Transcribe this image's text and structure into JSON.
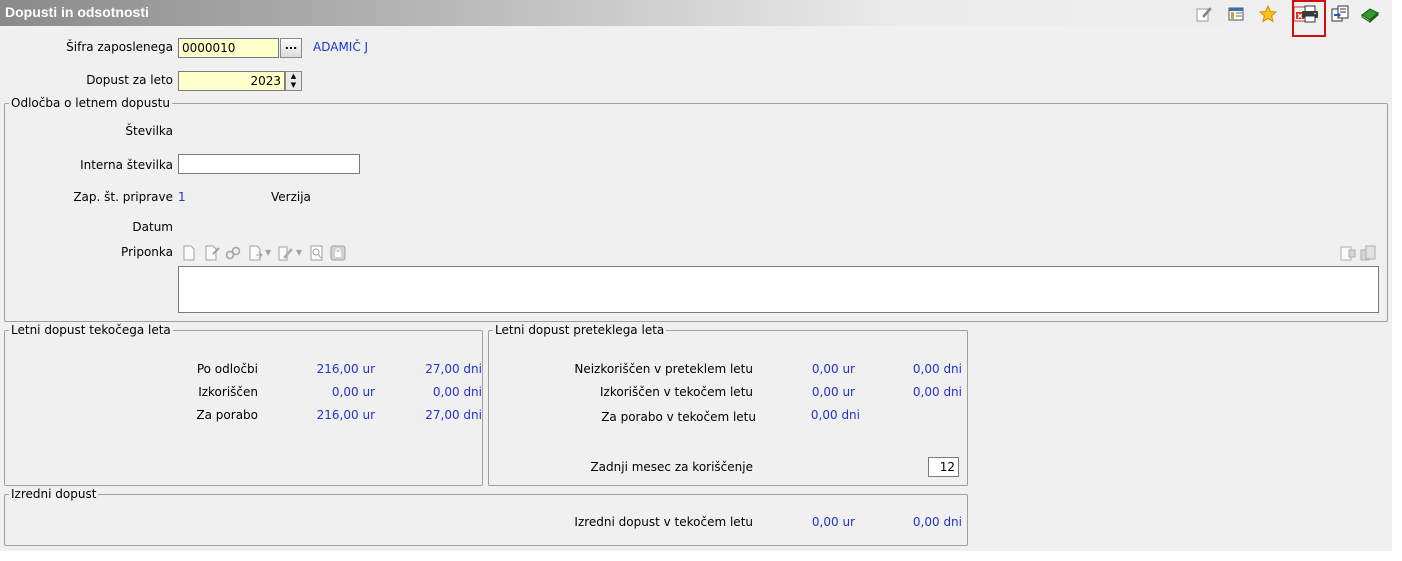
{
  "window": {
    "title": "Dopusti in odsotnosti"
  },
  "toolbar": {
    "icons": [
      "edit-icon",
      "columns-icon",
      "star-icon",
      "pdf-icon",
      "printer-icon",
      "export-icon",
      "book-icon"
    ],
    "highlight_color": "#d01010"
  },
  "employee": {
    "label": "Šifra zaposlenega",
    "value": "0000010",
    "browse_label": "...",
    "name": "ADAMIČ J"
  },
  "year": {
    "label": "Dopust za leto",
    "value": "2023"
  },
  "decision": {
    "legend": "Odločba o letnem dopustu",
    "number_label": "Številka",
    "internal_label": "Interna številka",
    "internal_value": "",
    "seq_label": "Zap. št. priprave",
    "seq_value": "1",
    "version_label": "Verzija",
    "date_label": "Datum",
    "attachment_label": "Priponka"
  },
  "current": {
    "legend": "Letni dopust tekočega leta",
    "rows": [
      {
        "label": "Po odločbi",
        "hours": "216,00 ur",
        "days": "27,00 dni"
      },
      {
        "label": "Izkoriščen",
        "hours": "0,00 ur",
        "days": "0,00 dni"
      },
      {
        "label": "Za porabo",
        "hours": "216,00 ur",
        "days": "27,00 dni"
      }
    ]
  },
  "previous": {
    "legend": "Letni dopust preteklega leta",
    "unused_label": "Neizkoriščen v preteklem letu",
    "unused_hours": "0,00 ur",
    "unused_days": "0,00 dni",
    "used_label": "Izkoriščen v tekočem letu",
    "used_hours": "0,00 ur",
    "used_days": "0,00 dni",
    "avail_label": "Za porabo v tekočem letu",
    "avail_days": "0,00 dni",
    "lastmonth_label": "Zadnji mesec za koriščenje",
    "lastmonth_value": "12"
  },
  "extra": {
    "legend": "Izredni dopust",
    "label": "Izredni dopust v tekočem letu",
    "hours": "0,00 ur",
    "days": "0,00 dni"
  }
}
